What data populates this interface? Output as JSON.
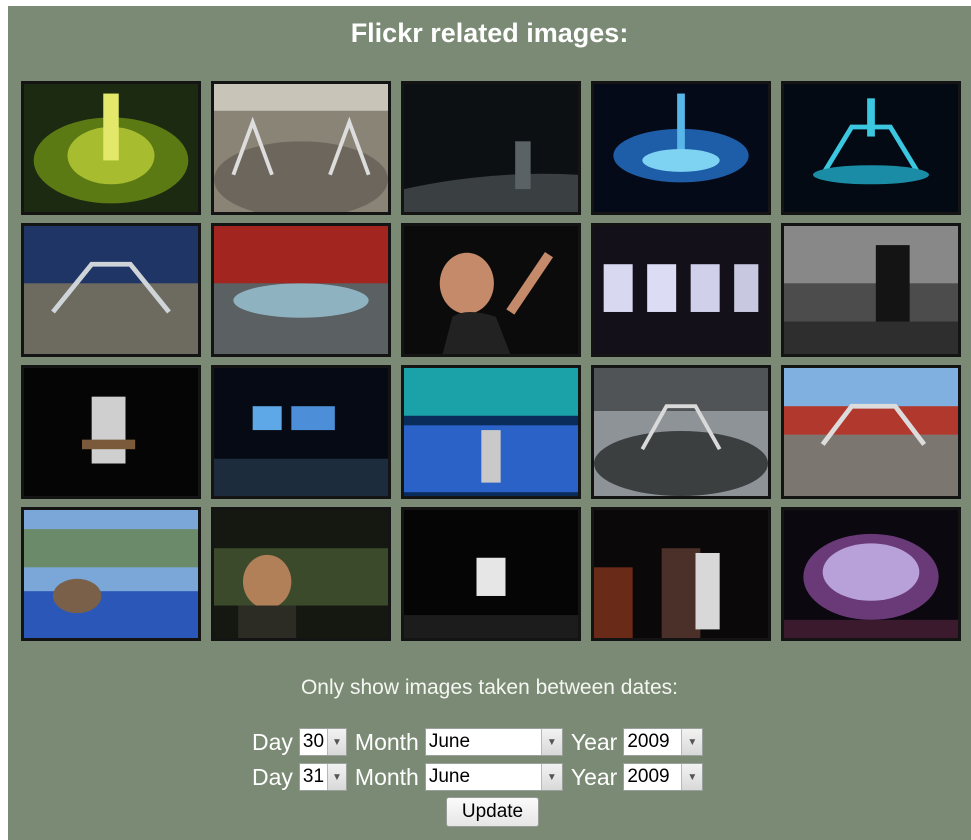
{
  "heading": "Flickr related images:",
  "images": [
    {
      "name": "stage-yellow-glow"
    },
    {
      "name": "stadium-daylight-overview"
    },
    {
      "name": "dark-crowd-silhouette"
    },
    {
      "name": "blue-lit-stage"
    },
    {
      "name": "cyan-claw-stage"
    },
    {
      "name": "stadium-dusk-stage"
    },
    {
      "name": "stadium-red-seats"
    },
    {
      "name": "singer-closeup"
    },
    {
      "name": "video-screen-faces"
    },
    {
      "name": "bw-singer-stage"
    },
    {
      "name": "guitarist-spotlight"
    },
    {
      "name": "stage-blue-screens"
    },
    {
      "name": "band-blue-screen"
    },
    {
      "name": "stadium-cloudy-sky"
    },
    {
      "name": "stadium-claw-daylight"
    },
    {
      "name": "fan-in-stands"
    },
    {
      "name": "fan-portrait-night"
    },
    {
      "name": "performer-white-shirt"
    },
    {
      "name": "singer-leather-jacket"
    },
    {
      "name": "lit-cylinder-screen"
    }
  ],
  "filter": {
    "caption": "Only show images taken between dates:",
    "day_label": "Day",
    "month_label": "Month",
    "year_label": "Year",
    "from": {
      "day": "30",
      "month": "June",
      "year": "2009"
    },
    "to": {
      "day": "31",
      "month": "June",
      "year": "2009"
    },
    "update_label": "Update"
  }
}
